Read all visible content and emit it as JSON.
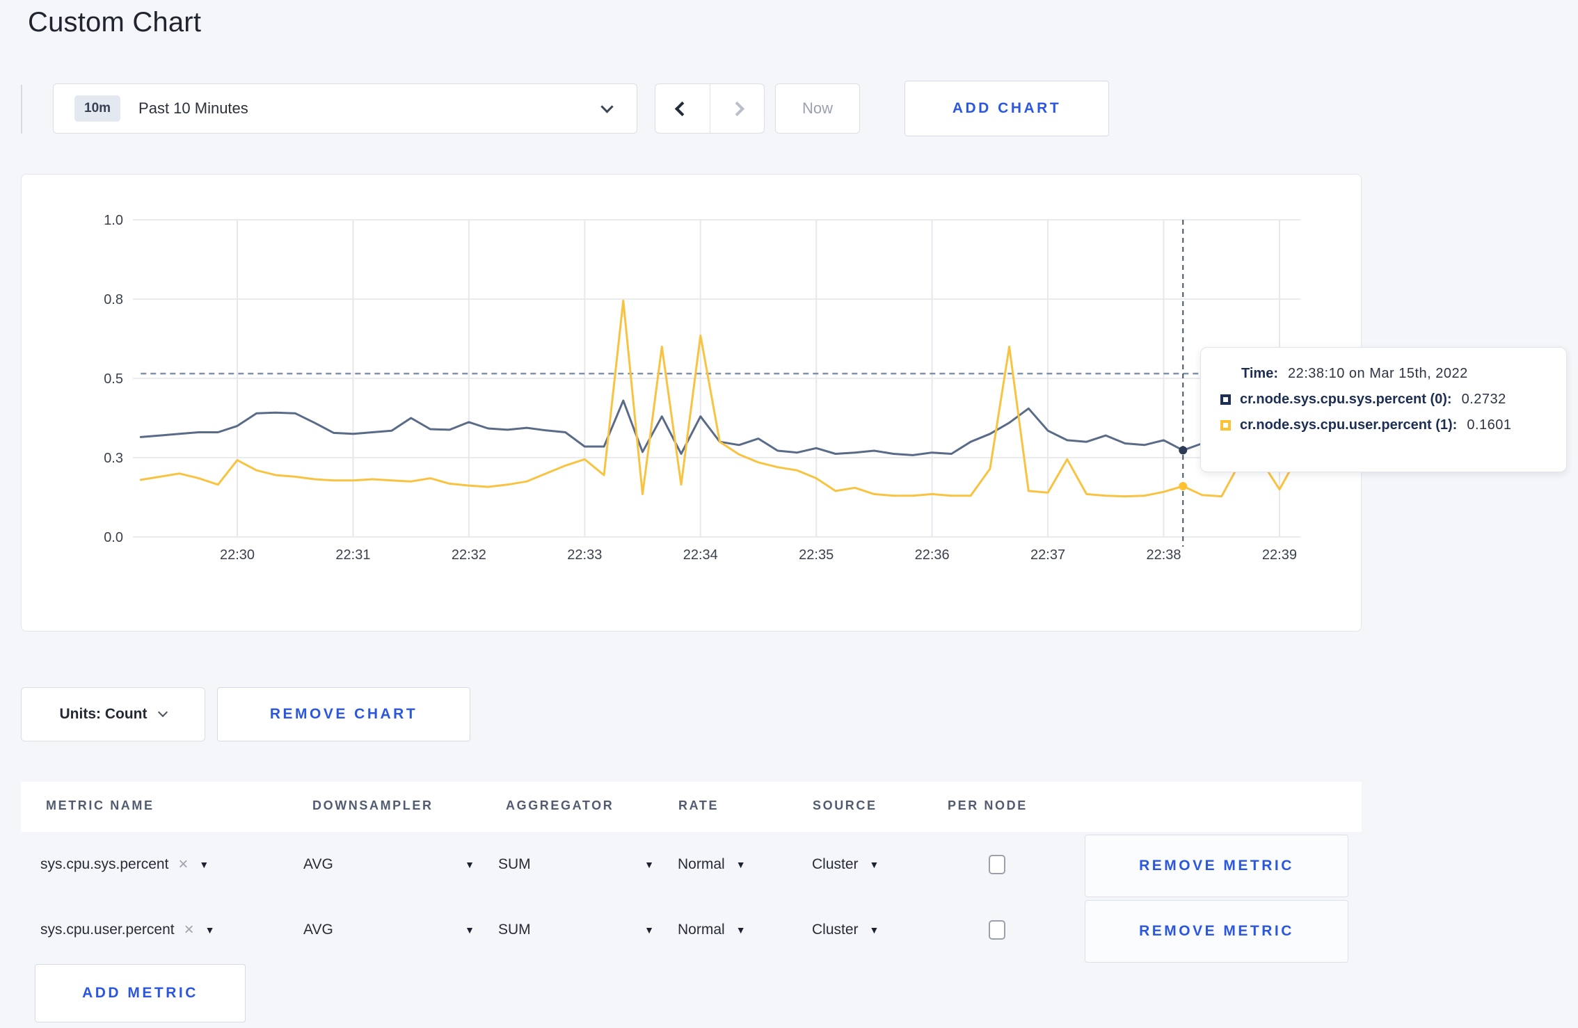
{
  "page": {
    "title": "Custom Chart"
  },
  "toolbar": {
    "time_window_badge": "10m",
    "time_window_label": "Past 10 Minutes",
    "now_label": "Now",
    "add_chart_label": "ADD CHART"
  },
  "icons": {
    "close": "×",
    "caret_down": "▼"
  },
  "colors": {
    "accent_blue": "#2b57e0",
    "series_sys": "#5a6b87",
    "series_user": "#f9c342",
    "tooltip_navy": "#1d2e55",
    "tooltip_yellow": "#fdc132",
    "page_bg": "#f4f6f9"
  },
  "chart_data": {
    "type": "line",
    "title": "",
    "grid": true,
    "ylim": [
      0,
      1
    ],
    "y_tick_labels": [
      "1.0",
      "0.8",
      "0.5",
      "0.3",
      "0.0"
    ],
    "y_tick_values": [
      1.0,
      0.75,
      0.5,
      0.25,
      0.0
    ],
    "x_tick_labels": [
      "22:30",
      "22:31",
      "22:32",
      "22:33",
      "22:34",
      "22:35",
      "22:36",
      "22:37",
      "22:38",
      "22:39"
    ],
    "x_start": "22:29:10",
    "x_step_seconds": 10,
    "threshold_value": 0.515,
    "legend_position": "tooltip",
    "hover": {
      "index": 54,
      "time": "22:38:10"
    },
    "series": [
      {
        "name": "cr.node.sys.cpu.sys.percent",
        "color": "#5a6b87",
        "dot_color": "#2c3a55",
        "values": [
          0.315,
          0.32,
          0.325,
          0.33,
          0.33,
          0.35,
          0.39,
          0.392,
          0.39,
          0.36,
          0.328,
          0.325,
          0.33,
          0.335,
          0.375,
          0.34,
          0.338,
          0.362,
          0.342,
          0.338,
          0.344,
          0.336,
          0.33,
          0.285,
          0.285,
          0.43,
          0.268,
          0.38,
          0.262,
          0.38,
          0.3,
          0.29,
          0.31,
          0.272,
          0.266,
          0.28,
          0.262,
          0.266,
          0.272,
          0.262,
          0.258,
          0.266,
          0.262,
          0.3,
          0.325,
          0.36,
          0.405,
          0.335,
          0.305,
          0.3,
          0.32,
          0.295,
          0.29,
          0.305,
          0.2732,
          0.295,
          0.3,
          0.295,
          0.3,
          0.31,
          0.305
        ]
      },
      {
        "name": "cr.node.sys.cpu.user.percent",
        "color": "#f9c342",
        "dot_color": "#fdc132",
        "values": [
          0.18,
          0.19,
          0.2,
          0.185,
          0.165,
          0.242,
          0.21,
          0.195,
          0.19,
          0.182,
          0.178,
          0.178,
          0.182,
          0.178,
          0.175,
          0.185,
          0.168,
          0.162,
          0.158,
          0.165,
          0.175,
          0.2,
          0.225,
          0.245,
          0.195,
          0.745,
          0.135,
          0.6,
          0.165,
          0.635,
          0.3,
          0.26,
          0.235,
          0.22,
          0.21,
          0.185,
          0.145,
          0.155,
          0.135,
          0.13,
          0.13,
          0.135,
          0.13,
          0.13,
          0.215,
          0.6,
          0.145,
          0.14,
          0.245,
          0.135,
          0.13,
          0.128,
          0.13,
          0.142,
          0.1601,
          0.132,
          0.128,
          0.24,
          0.245,
          0.15,
          0.26
        ]
      }
    ]
  },
  "tooltip": {
    "time_label": "Time:",
    "time_value": "22:38:10 on Mar 15th, 2022",
    "rows": [
      {
        "name": "cr.node.sys.cpu.sys.percent (0):",
        "value": "0.2732",
        "color": "#1d2e55"
      },
      {
        "name": "cr.node.sys.cpu.user.percent (1):",
        "value": "0.1601",
        "color": "#fdc132"
      }
    ]
  },
  "chart_controls": {
    "units_label": "Units: Count",
    "remove_chart_label": "REMOVE CHART"
  },
  "metrics_table": {
    "headers": [
      "METRIC NAME",
      "DOWNSAMPLER",
      "AGGREGATOR",
      "RATE",
      "SOURCE",
      "PER NODE"
    ],
    "rows": [
      {
        "metric": "sys.cpu.sys.percent",
        "downsampler": "AVG",
        "aggregator": "SUM",
        "rate": "Normal",
        "source": "Cluster",
        "per_node_checked": false,
        "remove_label": "REMOVE METRIC"
      },
      {
        "metric": "sys.cpu.user.percent",
        "downsampler": "AVG",
        "aggregator": "SUM",
        "rate": "Normal",
        "source": "Cluster",
        "per_node_checked": false,
        "remove_label": "REMOVE METRIC"
      }
    ],
    "add_metric_label": "ADD METRIC"
  }
}
